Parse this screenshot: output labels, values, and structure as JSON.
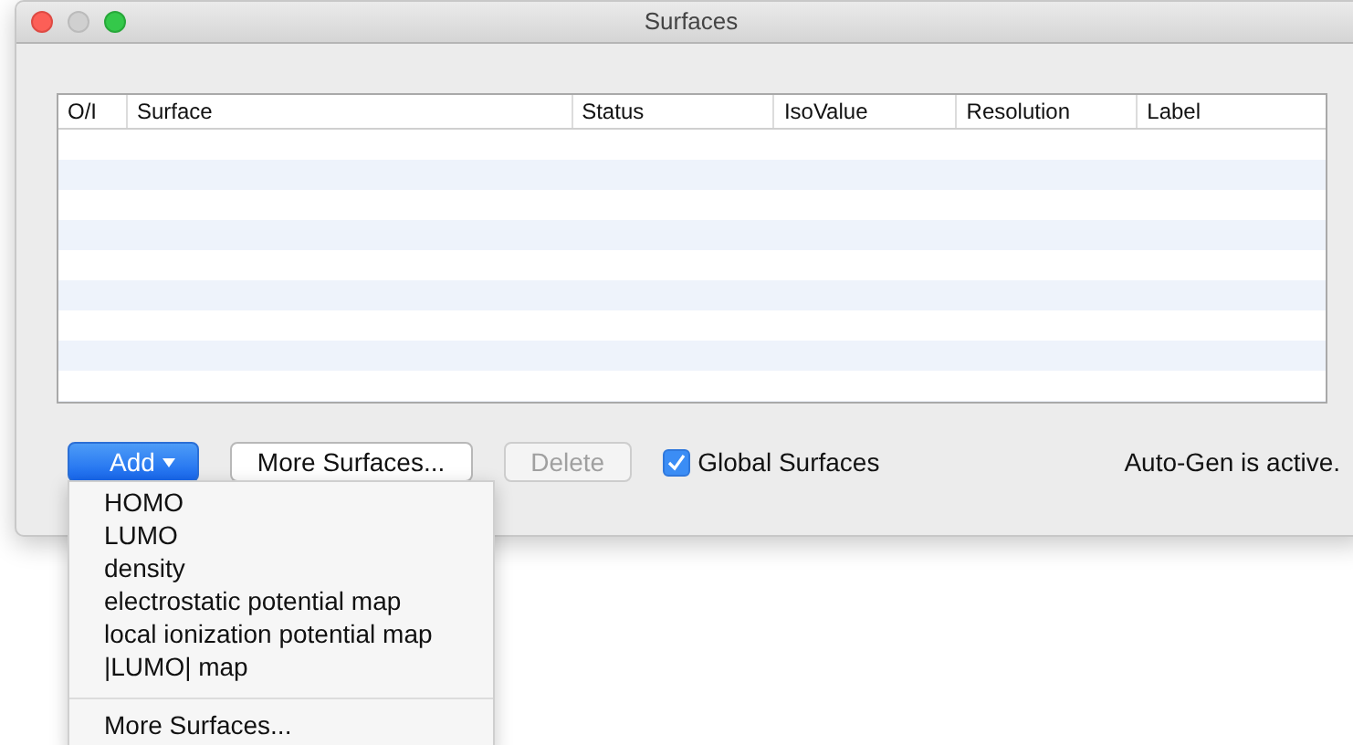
{
  "window": {
    "title": "Surfaces"
  },
  "table": {
    "columns": [
      "O/I",
      "Surface",
      "Status",
      "IsoValue",
      "Resolution",
      "Label"
    ]
  },
  "buttons": [
    {
      "label": "Add",
      "kind": "menu",
      "disabled": false
    },
    {
      "label": "More Surfaces...",
      "kind": "push",
      "disabled": false
    },
    {
      "label": "Delete",
      "kind": "push",
      "disabled": true
    }
  ],
  "global_surfaces": {
    "label": "Global Surfaces",
    "checked": true
  },
  "status": "Auto-Gen is active.",
  "add_menu": {
    "items": [
      {
        "label": "HOMO",
        "kind": "item"
      },
      {
        "label": "LUMO",
        "kind": "item"
      },
      {
        "label": "density",
        "kind": "item"
      },
      {
        "label": "electrostatic potential map",
        "kind": "item"
      },
      {
        "label": "local ionization potential map",
        "kind": "item"
      },
      {
        "label": "|LUMO| map",
        "kind": "item"
      },
      {
        "label": "More Surfaces...",
        "kind": "separated"
      }
    ]
  }
}
